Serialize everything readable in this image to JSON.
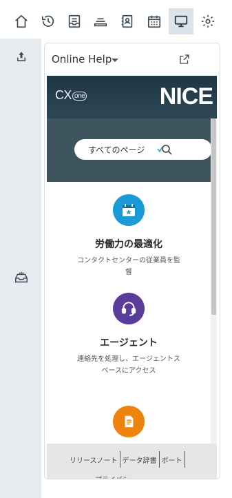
{
  "toolbar": {
    "icons": [
      "home-icon",
      "history-icon",
      "inbox-icon",
      "queue-icon",
      "contacts-icon",
      "calendar-icon",
      "screen-icon",
      "gear-icon"
    ],
    "active": "screen-icon"
  },
  "rail": {
    "icons": [
      "upload-icon",
      "tray-icon"
    ]
  },
  "panel": {
    "title": "Online Help",
    "banner": {
      "left_logo_prefix": "CX",
      "left_logo_suffix": "one",
      "right_logo": "NICE"
    },
    "search": {
      "scope": "すべてのページ"
    },
    "cards": [
      {
        "title": "労働力の最適化",
        "desc": "コンタクトセンターの従業員を監督",
        "color": "#1a9ad6",
        "icon": "calendar-star-icon"
      },
      {
        "title": "エージェント",
        "desc": "連絡先を処理し、エージェントスペースにアクセス",
        "color": "#5b3b9c",
        "icon": "headset-icon"
      },
      {
        "title": "",
        "desc": "",
        "color": "#f0820e",
        "icon": "document-icon"
      }
    ],
    "footer": {
      "links": [
        "リリースノート",
        "データ辞書",
        "ポート"
      ],
      "cut_text": "プライバシー"
    }
  },
  "colors": {
    "banner": "#1f3644",
    "search_band": "#3e5560",
    "rail": "#e6ebf0",
    "footer": "#e6e6e6"
  }
}
